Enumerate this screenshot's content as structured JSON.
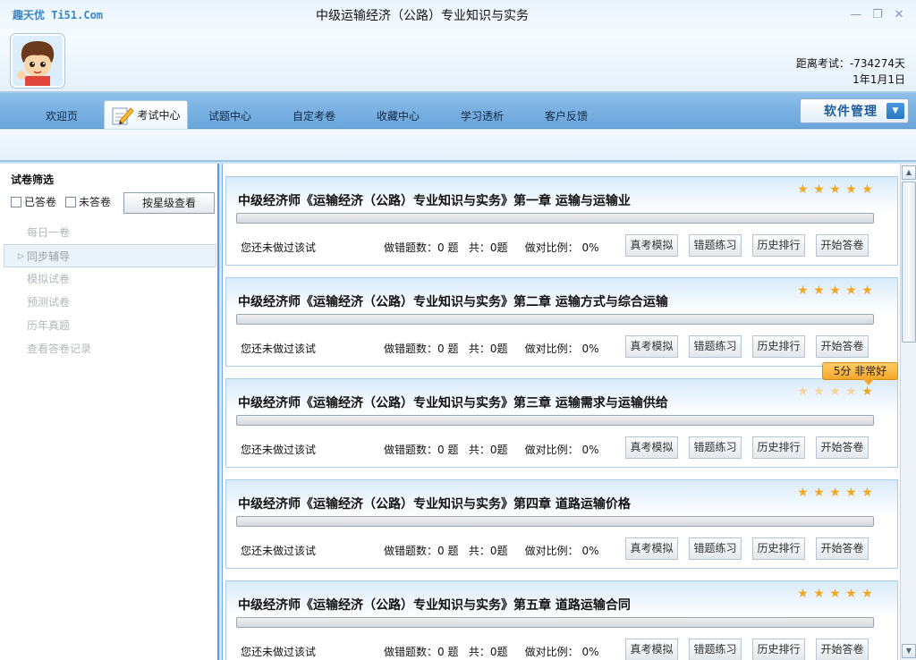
{
  "window": {
    "logo": "趣天优 Ti51.Com",
    "title": "中级运输经济（公路）专业知识与实务"
  },
  "exam_info": {
    "countdown": "距离考试：-734274天",
    "date": "1年1月1日"
  },
  "nav": {
    "tabs": [
      "欢迎页",
      "考试中心",
      "试题中心",
      "自定考卷",
      "收藏中心",
      "学习透析",
      "客户反馈"
    ],
    "active_index": 1,
    "software_manage": "软件管理"
  },
  "sidebar": {
    "title": "试卷筛选",
    "filter_answered": "已答卷",
    "filter_unanswered": "未答卷",
    "star_button": "按星级查看",
    "items": [
      "每日一卷",
      "同步辅导",
      "模拟试卷",
      "预测试卷",
      "历年真题",
      "查看答卷记录"
    ],
    "active_index": 1
  },
  "card_labels": {
    "status": "您还未做过该试",
    "wrong": "做错题数：0 题",
    "total": "共：0题",
    "ratio": "做对比例： 0%",
    "btn_sim": "真考模拟",
    "btn_wrong": "错题练习",
    "btn_rank": "历史排行",
    "btn_start": "开始答卷"
  },
  "cards": [
    {
      "title": "中级经济师《运输经济（公路）专业知识与实务》第一章 运输与运输业",
      "stars": 5
    },
    {
      "title": "中级经济师《运输经济（公路）专业知识与实务》第二章 运输方式与综合运输",
      "stars": 5
    },
    {
      "title": "中级经济师《运输经济（公路）专业知识与实务》第三章 运输需求与运输供给",
      "stars": 5
    },
    {
      "title": "中级经济师《运输经济（公路）专业知识与实务》第四章 道路运输价格",
      "stars": 5
    },
    {
      "title": "中级经济师《运输经济（公路）专业知识与实务》第五章 道路运输合同",
      "stars": 5
    }
  ],
  "tooltip": "5分 非常好"
}
